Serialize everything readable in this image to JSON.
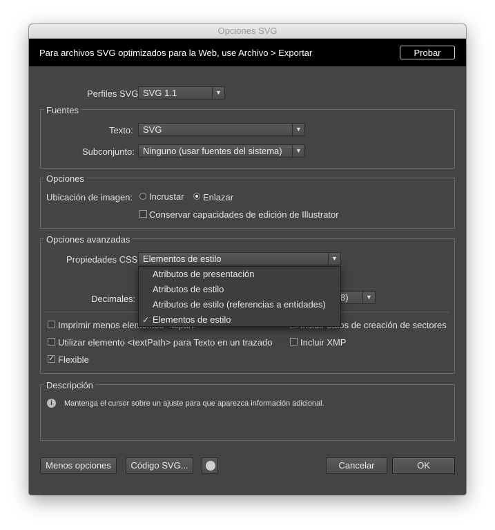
{
  "window": {
    "title": "Opciones SVG"
  },
  "banner": {
    "text": "Para archivos SVG optimizados para la Web, use Archivo > Exportar",
    "probar_label": "Probar"
  },
  "profile": {
    "label": "Perfiles SVG",
    "value": "SVG 1.1"
  },
  "fonts": {
    "title": "Fuentes",
    "text_label": "Texto:",
    "text_value": "SVG",
    "subset_label": "Subconjunto:",
    "subset_value": "Ninguno (usar fuentes del sistema)"
  },
  "options": {
    "title": "Opciones",
    "image_location_label": "Ubicación de imagen:",
    "radio_embed": "Incrustar",
    "radio_link": "Enlazar",
    "selected": "Enlazar",
    "preserve_label": "Conservar capacidades de edición de Illustrator",
    "preserve_checked": false
  },
  "advanced": {
    "title": "Opciones avanzadas",
    "css_label": "Propiedades CSS:",
    "css_value": "Elementos de estilo",
    "css_options": [
      "Atributos de presentación",
      "Atributos de estilo",
      "Atributos de estilo (referencias a entidades)",
      "Elementos de estilo"
    ],
    "decimals_label": "Decimales:",
    "hidden_value_fragment": "8)",
    "checks": {
      "tspan_label": "Imprimir menos elementos <tspan>",
      "tspan_checked": false,
      "slices_label": "Incluir datos de creación de sectores",
      "slices_checked": false,
      "textpath_label": "Utilizar elemento <textPath> para Texto en un trazado",
      "textpath_checked": false,
      "xmp_label": "Incluir XMP",
      "xmp_checked": false,
      "responsive_label": "Flexible",
      "responsive_checked": true
    }
  },
  "description": {
    "title": "Descripción",
    "text": "Mantenga el cursor sobre un ajuste para que aparezca información adicional."
  },
  "footer": {
    "less_options": "Menos opciones",
    "svg_code": "Código SVG...",
    "cancel": "Cancelar",
    "ok": "OK"
  },
  "icons": {
    "dropdown_arrow": "▼",
    "checkmark": "✓",
    "info": "i"
  }
}
